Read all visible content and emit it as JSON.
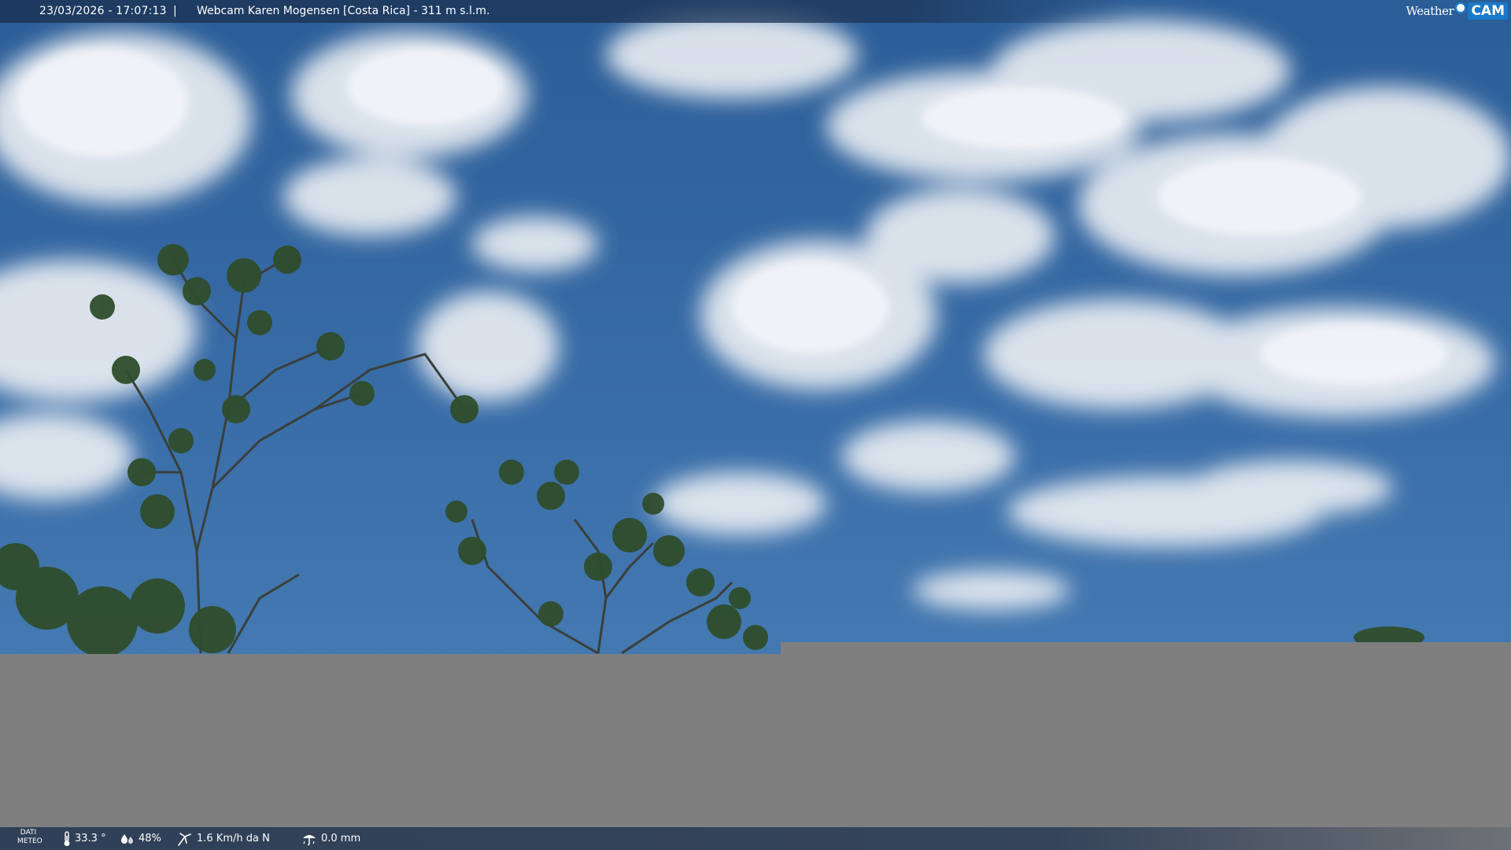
{
  "header": {
    "timestamp": "23/03/2026 - 17:07:13",
    "separator": "|",
    "title": "Webcam Karen Mogensen [Costa Rica] - 311 m s.l.m.",
    "logo": {
      "weather_text": "Weather",
      "cam_text": "CAM",
      "accent": "#1a78c8"
    }
  },
  "scene": {
    "sky_color": "#3a6ea8",
    "gray_area_color": "#7f7f7f"
  },
  "footer": {
    "label_line1": "DATI",
    "label_line2": "METEO",
    "temperature": "33.3 °",
    "humidity": "48%",
    "wind": "1.6 Km/h da N",
    "rain": "0.0 mm",
    "icons": [
      "thermometer-icon",
      "humidity-icon",
      "wind-icon",
      "rain-icon"
    ]
  }
}
